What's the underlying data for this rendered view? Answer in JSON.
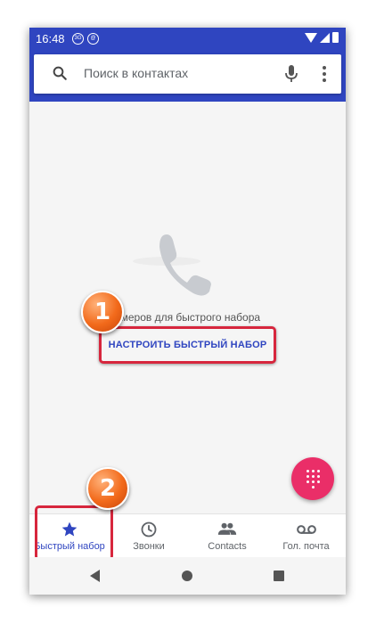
{
  "status": {
    "time": "16:48",
    "icon1": "3G",
    "icon2": "@"
  },
  "search": {
    "placeholder": "Поиск в контактах"
  },
  "empty": {
    "text": "омеров для быстрого набора",
    "setup_button": "НАСТРОИТЬ БЫСТРЫЙ НАБОР"
  },
  "callouts": {
    "one": "1",
    "two": "2"
  },
  "tabs": [
    {
      "label": "Быстрый набор",
      "icon": "star-icon",
      "active": true
    },
    {
      "label": "Звонки",
      "icon": "clock-icon"
    },
    {
      "label": "Contacts",
      "icon": "people-icon"
    },
    {
      "label": "Гол. почта",
      "icon": "voicemail-icon"
    }
  ],
  "colors": {
    "primary": "#2f45c0",
    "fab": "#ea2e68",
    "highlight": "#d7263d",
    "callout": "#f26a1b"
  }
}
